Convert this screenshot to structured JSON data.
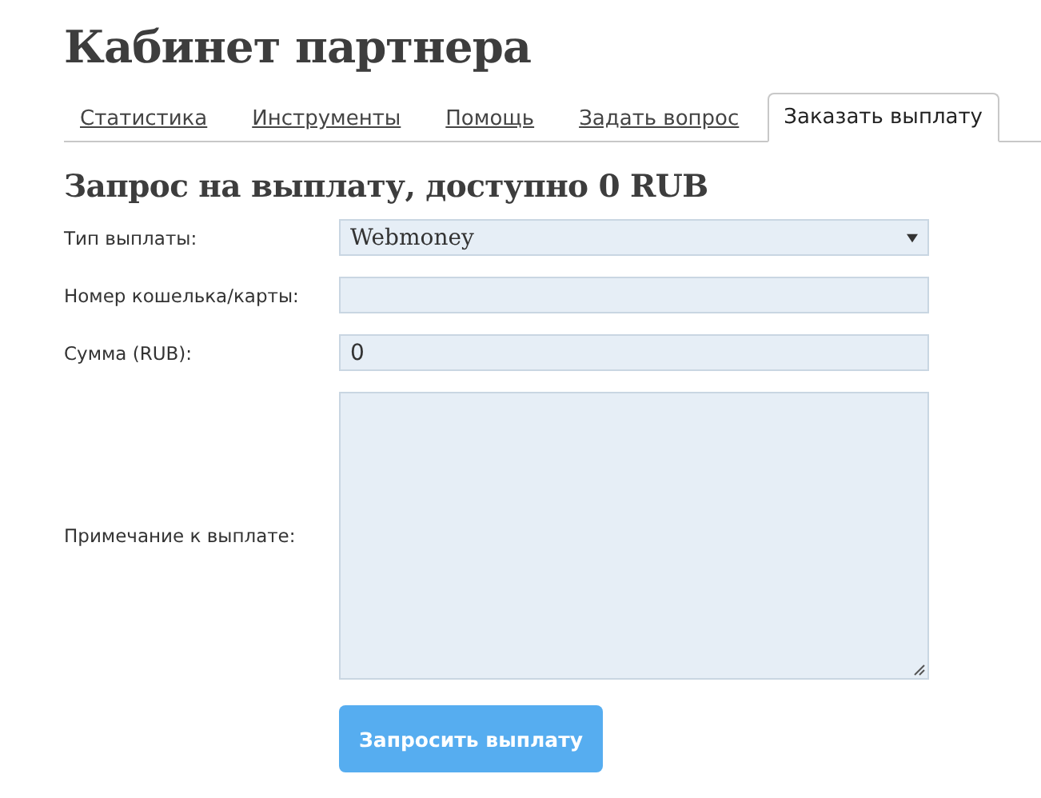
{
  "page_title": "Кабинет партнера",
  "tabs": [
    {
      "label": "Статистика",
      "selected": false
    },
    {
      "label": "Инструменты",
      "selected": false
    },
    {
      "label": "Помощь",
      "selected": false
    },
    {
      "label": "Задать вопрос",
      "selected": false
    },
    {
      "label": "Заказать выплату",
      "selected": true
    }
  ],
  "form": {
    "heading": "Запрос на выплату, доступно 0 RUB",
    "fields": [
      {
        "kind": "select",
        "label": "Тип выплаты:",
        "value": "Webmoney"
      },
      {
        "kind": "input",
        "label": "Номер кошелька/карты:"
      },
      {
        "kind": "input",
        "label": "Сумма (RUB):",
        "value": "0"
      },
      {
        "kind": "textarea",
        "label": "Примечание к выплате:"
      }
    ],
    "submit": "Запросить выплату"
  }
}
